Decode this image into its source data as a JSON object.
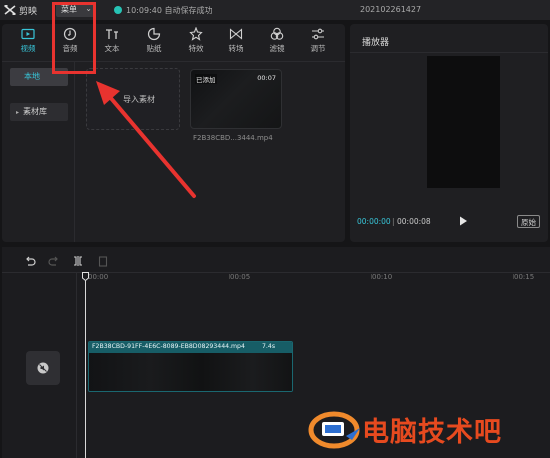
{
  "titlebar": {
    "app_name": "剪映",
    "menu_label": "菜单",
    "save_status": "10:09:40 自动保存成功",
    "project_name": "202102261427"
  },
  "toolbar": {
    "tabs": [
      {
        "label": "视频",
        "icon": "video-icon",
        "active": true
      },
      {
        "label": "音频",
        "icon": "audio-icon",
        "active": false
      },
      {
        "label": "文本",
        "icon": "text-icon",
        "active": false
      },
      {
        "label": "贴纸",
        "icon": "sticker-icon",
        "active": false
      },
      {
        "label": "特效",
        "icon": "effects-icon",
        "active": false
      },
      {
        "label": "转场",
        "icon": "transition-icon",
        "active": false
      },
      {
        "label": "滤镜",
        "icon": "filter-icon",
        "active": false
      },
      {
        "label": "调节",
        "icon": "adjust-icon",
        "active": false
      }
    ]
  },
  "sidebar": {
    "items": [
      {
        "label": "本地",
        "active": true
      },
      {
        "label": "素材库",
        "active": false
      }
    ]
  },
  "media": {
    "import_label": "导入素材",
    "clip": {
      "badge": "已添加",
      "duration": "00:07",
      "filename": "F2B38CBD...3444.mp4"
    }
  },
  "player": {
    "title": "播放器",
    "current_time": "00:00:00",
    "separator": "|",
    "total_time": "00:00:08",
    "original_label": "原始"
  },
  "timeline": {
    "ruler_labels": [
      "00:00",
      "00:05",
      "00:10",
      "00:15"
    ],
    "clip": {
      "name": "F2B38CBD-91FF-4E6C-8089-EB8D08293444.mp4",
      "duration": "7.4s"
    }
  },
  "annotation": {
    "color": "#e8332f"
  },
  "watermark": {
    "text": "电脑技术吧"
  },
  "colors": {
    "accent": "#38c5d8",
    "clip_header": "#175d66",
    "watermark": "#e74a1f"
  }
}
